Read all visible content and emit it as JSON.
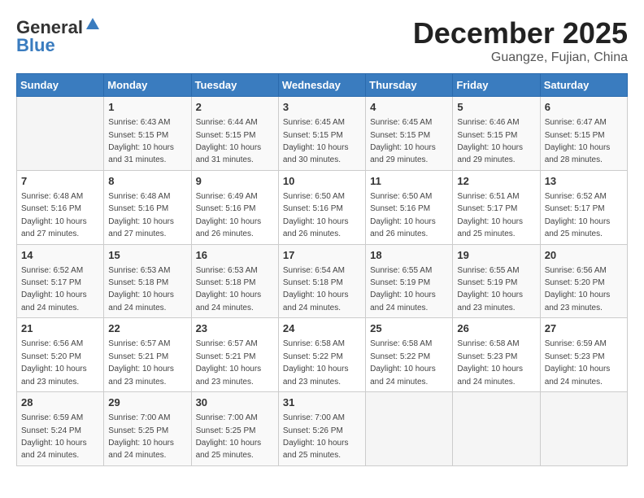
{
  "header": {
    "logo_general": "General",
    "logo_blue": "Blue",
    "month": "December 2025",
    "location": "Guangze, Fujian, China"
  },
  "weekdays": [
    "Sunday",
    "Monday",
    "Tuesday",
    "Wednesday",
    "Thursday",
    "Friday",
    "Saturday"
  ],
  "weeks": [
    [
      {
        "day": "",
        "sunrise": "",
        "sunset": "",
        "daylight": "",
        "empty": true
      },
      {
        "day": "1",
        "sunrise": "Sunrise: 6:43 AM",
        "sunset": "Sunset: 5:15 PM",
        "daylight": "Daylight: 10 hours and 31 minutes."
      },
      {
        "day": "2",
        "sunrise": "Sunrise: 6:44 AM",
        "sunset": "Sunset: 5:15 PM",
        "daylight": "Daylight: 10 hours and 31 minutes."
      },
      {
        "day": "3",
        "sunrise": "Sunrise: 6:45 AM",
        "sunset": "Sunset: 5:15 PM",
        "daylight": "Daylight: 10 hours and 30 minutes."
      },
      {
        "day": "4",
        "sunrise": "Sunrise: 6:45 AM",
        "sunset": "Sunset: 5:15 PM",
        "daylight": "Daylight: 10 hours and 29 minutes."
      },
      {
        "day": "5",
        "sunrise": "Sunrise: 6:46 AM",
        "sunset": "Sunset: 5:15 PM",
        "daylight": "Daylight: 10 hours and 29 minutes."
      },
      {
        "day": "6",
        "sunrise": "Sunrise: 6:47 AM",
        "sunset": "Sunset: 5:15 PM",
        "daylight": "Daylight: 10 hours and 28 minutes."
      }
    ],
    [
      {
        "day": "7",
        "sunrise": "Sunrise: 6:48 AM",
        "sunset": "Sunset: 5:16 PM",
        "daylight": "Daylight: 10 hours and 27 minutes."
      },
      {
        "day": "8",
        "sunrise": "Sunrise: 6:48 AM",
        "sunset": "Sunset: 5:16 PM",
        "daylight": "Daylight: 10 hours and 27 minutes."
      },
      {
        "day": "9",
        "sunrise": "Sunrise: 6:49 AM",
        "sunset": "Sunset: 5:16 PM",
        "daylight": "Daylight: 10 hours and 26 minutes."
      },
      {
        "day": "10",
        "sunrise": "Sunrise: 6:50 AM",
        "sunset": "Sunset: 5:16 PM",
        "daylight": "Daylight: 10 hours and 26 minutes."
      },
      {
        "day": "11",
        "sunrise": "Sunrise: 6:50 AM",
        "sunset": "Sunset: 5:16 PM",
        "daylight": "Daylight: 10 hours and 26 minutes."
      },
      {
        "day": "12",
        "sunrise": "Sunrise: 6:51 AM",
        "sunset": "Sunset: 5:17 PM",
        "daylight": "Daylight: 10 hours and 25 minutes."
      },
      {
        "day": "13",
        "sunrise": "Sunrise: 6:52 AM",
        "sunset": "Sunset: 5:17 PM",
        "daylight": "Daylight: 10 hours and 25 minutes."
      }
    ],
    [
      {
        "day": "14",
        "sunrise": "Sunrise: 6:52 AM",
        "sunset": "Sunset: 5:17 PM",
        "daylight": "Daylight: 10 hours and 24 minutes."
      },
      {
        "day": "15",
        "sunrise": "Sunrise: 6:53 AM",
        "sunset": "Sunset: 5:18 PM",
        "daylight": "Daylight: 10 hours and 24 minutes."
      },
      {
        "day": "16",
        "sunrise": "Sunrise: 6:53 AM",
        "sunset": "Sunset: 5:18 PM",
        "daylight": "Daylight: 10 hours and 24 minutes."
      },
      {
        "day": "17",
        "sunrise": "Sunrise: 6:54 AM",
        "sunset": "Sunset: 5:18 PM",
        "daylight": "Daylight: 10 hours and 24 minutes."
      },
      {
        "day": "18",
        "sunrise": "Sunrise: 6:55 AM",
        "sunset": "Sunset: 5:19 PM",
        "daylight": "Daylight: 10 hours and 24 minutes."
      },
      {
        "day": "19",
        "sunrise": "Sunrise: 6:55 AM",
        "sunset": "Sunset: 5:19 PM",
        "daylight": "Daylight: 10 hours and 23 minutes."
      },
      {
        "day": "20",
        "sunrise": "Sunrise: 6:56 AM",
        "sunset": "Sunset: 5:20 PM",
        "daylight": "Daylight: 10 hours and 23 minutes."
      }
    ],
    [
      {
        "day": "21",
        "sunrise": "Sunrise: 6:56 AM",
        "sunset": "Sunset: 5:20 PM",
        "daylight": "Daylight: 10 hours and 23 minutes."
      },
      {
        "day": "22",
        "sunrise": "Sunrise: 6:57 AM",
        "sunset": "Sunset: 5:21 PM",
        "daylight": "Daylight: 10 hours and 23 minutes."
      },
      {
        "day": "23",
        "sunrise": "Sunrise: 6:57 AM",
        "sunset": "Sunset: 5:21 PM",
        "daylight": "Daylight: 10 hours and 23 minutes."
      },
      {
        "day": "24",
        "sunrise": "Sunrise: 6:58 AM",
        "sunset": "Sunset: 5:22 PM",
        "daylight": "Daylight: 10 hours and 23 minutes."
      },
      {
        "day": "25",
        "sunrise": "Sunrise: 6:58 AM",
        "sunset": "Sunset: 5:22 PM",
        "daylight": "Daylight: 10 hours and 24 minutes."
      },
      {
        "day": "26",
        "sunrise": "Sunrise: 6:58 AM",
        "sunset": "Sunset: 5:23 PM",
        "daylight": "Daylight: 10 hours and 24 minutes."
      },
      {
        "day": "27",
        "sunrise": "Sunrise: 6:59 AM",
        "sunset": "Sunset: 5:23 PM",
        "daylight": "Daylight: 10 hours and 24 minutes."
      }
    ],
    [
      {
        "day": "28",
        "sunrise": "Sunrise: 6:59 AM",
        "sunset": "Sunset: 5:24 PM",
        "daylight": "Daylight: 10 hours and 24 minutes."
      },
      {
        "day": "29",
        "sunrise": "Sunrise: 7:00 AM",
        "sunset": "Sunset: 5:25 PM",
        "daylight": "Daylight: 10 hours and 24 minutes."
      },
      {
        "day": "30",
        "sunrise": "Sunrise: 7:00 AM",
        "sunset": "Sunset: 5:25 PM",
        "daylight": "Daylight: 10 hours and 25 minutes."
      },
      {
        "day": "31",
        "sunrise": "Sunrise: 7:00 AM",
        "sunset": "Sunset: 5:26 PM",
        "daylight": "Daylight: 10 hours and 25 minutes."
      },
      {
        "day": "",
        "sunrise": "",
        "sunset": "",
        "daylight": "",
        "empty": true
      },
      {
        "day": "",
        "sunrise": "",
        "sunset": "",
        "daylight": "",
        "empty": true
      },
      {
        "day": "",
        "sunrise": "",
        "sunset": "",
        "daylight": "",
        "empty": true
      }
    ]
  ]
}
